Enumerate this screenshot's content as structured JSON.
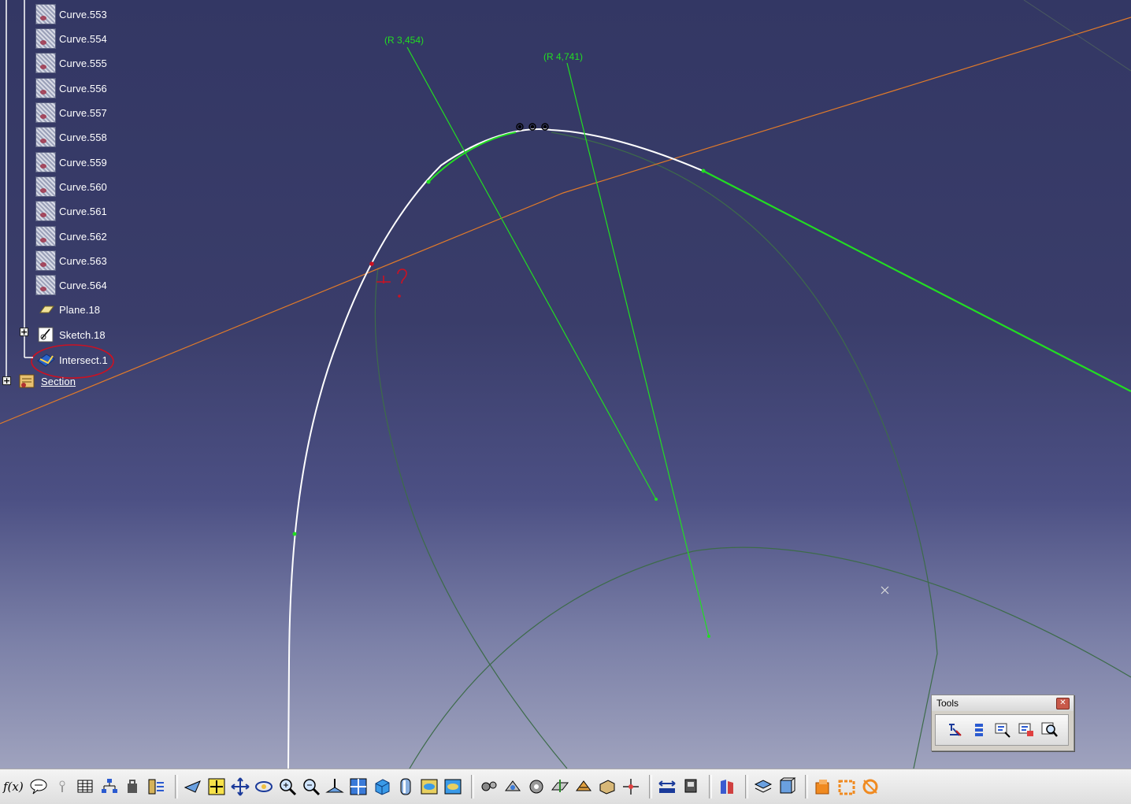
{
  "tree": {
    "curves": [
      "Curve.553",
      "Curve.554",
      "Curve.555",
      "Curve.556",
      "Curve.557",
      "Curve.558",
      "Curve.559",
      "Curve.560",
      "Curve.561",
      "Curve.562",
      "Curve.563",
      "Curve.564"
    ],
    "plane": "Plane.18",
    "sketch": "Sketch.18",
    "intersect": "Intersect.1",
    "section": "Section"
  },
  "annotations": {
    "radius_1": "(R 3,454)",
    "radius_2": "(R 4,741)"
  },
  "tools_panel": {
    "title": "Tools",
    "close_icon": "close-icon",
    "icons": [
      "constraint-icon",
      "align-icon",
      "tree-expand-icon",
      "tree-collapse-icon",
      "zoom-find-icon"
    ]
  },
  "bottom_toolbar": {
    "formula_label": "f(x)",
    "icons": [
      "formula-icon",
      "comment-icon",
      "light-icon",
      "table-icon",
      "graph-icon",
      "macro-icon",
      "catalog-icon",
      "fly-icon",
      "fit-all-icon",
      "pan-icon",
      "rotate-icon",
      "zoom-in-icon",
      "zoom-out-icon",
      "normal-view-icon",
      "multi-view-icon",
      "iso-view-icon",
      "shading-icon",
      "hide-show-icon",
      "swap-space-icon",
      "gear-icon",
      "assembly-icon",
      "settings-icon",
      "plane-icon",
      "render-icon",
      "material-icon",
      "compass-icon",
      "measure-icon",
      "apply-material-icon",
      "color-icon",
      "layer-icon",
      "cube-icon",
      "orange-1-icon",
      "orange-2-icon",
      "orange-3-icon"
    ]
  },
  "colors": {
    "accent_green": "#22dd22",
    "highlight_red": "#cc1122",
    "orange_line": "#e07a2a"
  }
}
